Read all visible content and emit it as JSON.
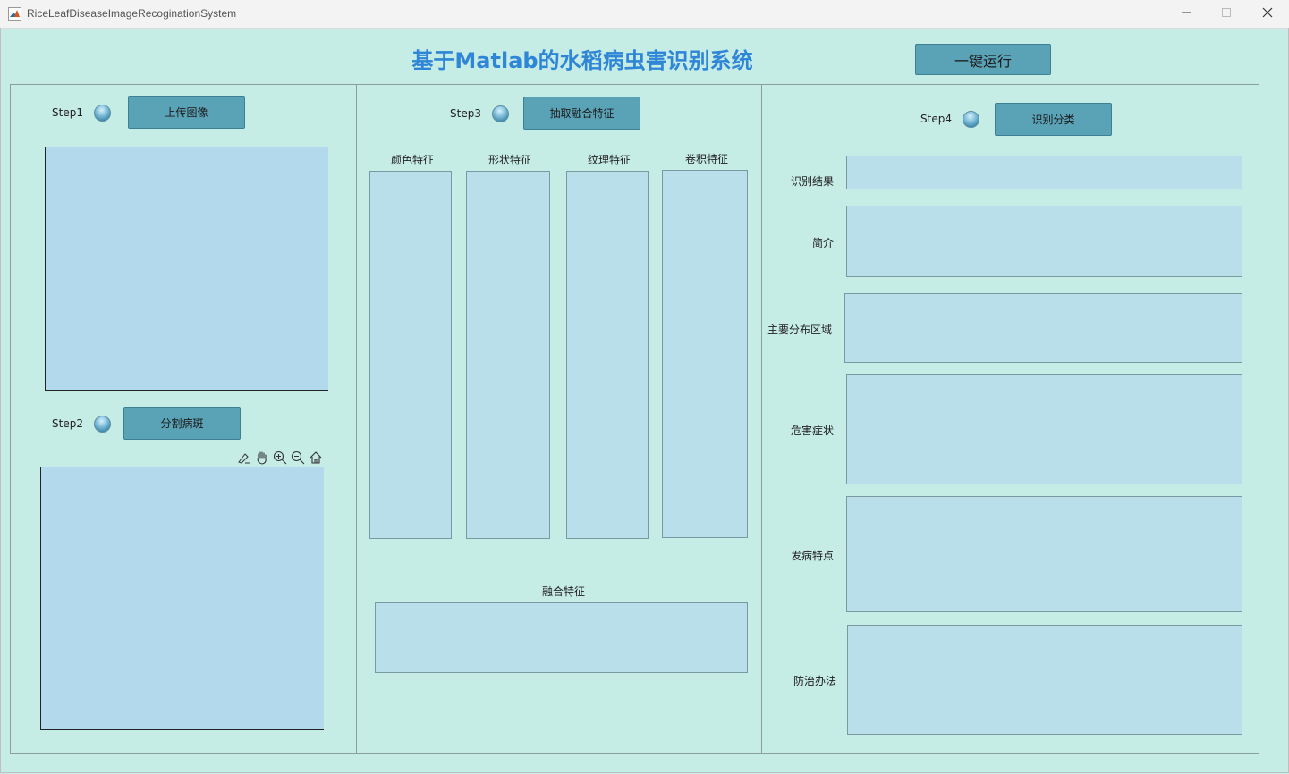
{
  "window": {
    "title": "RiceLeafDiseaseImageRecoginationSystem"
  },
  "header": {
    "title": "基于Matlab的水稻病虫害识别系统",
    "run_button": "一键运行"
  },
  "step1": {
    "label": "Step1",
    "button": "上传图像"
  },
  "step2": {
    "label": "Step2",
    "button": "分割病斑"
  },
  "step3": {
    "label": "Step3",
    "button": "抽取融合特征",
    "features": [
      "颜色特征",
      "形状特征",
      "纹理特征",
      "卷积特征"
    ],
    "fused_label": "融合特征"
  },
  "step4": {
    "label": "Step4",
    "button": "识别分类",
    "fields": [
      "识别结果",
      "简介",
      "主要分布区域",
      "危害症状",
      "发病特点",
      "防治办法"
    ]
  },
  "colors": {
    "background": "#c6ece6",
    "button": "#5aa2b6",
    "title": "#2f86d6",
    "axes": "#b2d9ec",
    "textbox": "#b8dfea"
  },
  "icons": [
    "matlab-icon",
    "minimize-icon",
    "maximize-icon",
    "close-icon",
    "brush-icon",
    "pan-hand-icon",
    "zoom-in-icon",
    "zoom-out-icon",
    "home-icon"
  ]
}
